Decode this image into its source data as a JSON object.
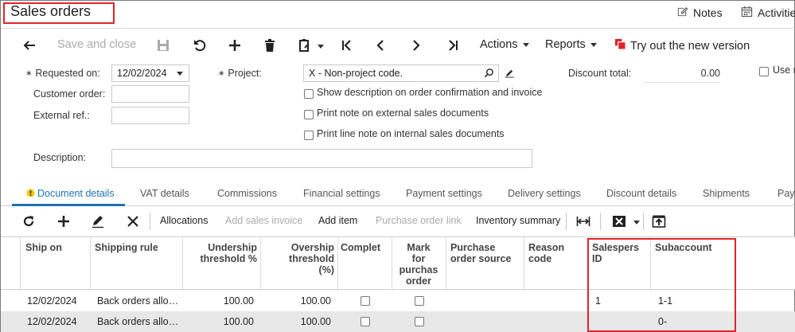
{
  "header": {
    "title": "Sales orders",
    "notes_label": "Notes",
    "activities_label": "Activitie"
  },
  "toolbar": {
    "save_close_label": "Save and close",
    "actions_label": "Actions",
    "reports_label": "Reports",
    "try_new_label": "Try out the new version"
  },
  "form": {
    "requested_on_label": "Requested on:",
    "requested_on_value": "12/02/2024",
    "customer_order_label": "Customer order:",
    "external_ref_label": "External ref.:",
    "description_label": "Description:",
    "project_label": "Project:",
    "project_value": "X - Non-project code.",
    "show_desc_label": "Show description on order confirmation and invoice",
    "print_note_external_label": "Print note on external sales documents",
    "print_line_note_label": "Print line note on internal sales documents",
    "discount_total_label": "Discount total:",
    "discount_total_value": "0.00",
    "use_label": "Use r"
  },
  "tabs": [
    {
      "label": "Document details"
    },
    {
      "label": "VAT details"
    },
    {
      "label": "Commissions"
    },
    {
      "label": "Financial settings"
    },
    {
      "label": "Payment settings"
    },
    {
      "label": "Delivery settings"
    },
    {
      "label": "Discount details"
    },
    {
      "label": "Shipments"
    },
    {
      "label": "Pay"
    }
  ],
  "grid_toolbar": {
    "allocations_label": "Allocations",
    "add_sales_invoice_label": "Add sales invoice",
    "add_item_label": "Add item",
    "purchase_order_link_label": "Purchase order link",
    "inventory_summary_label": "Inventory summary"
  },
  "grid": {
    "headers": {
      "ship_on": "Ship on",
      "shipping_rule": "Shipping rule",
      "undership_1": "Undership",
      "undership_2": "threshold %",
      "overship_1": "Overship",
      "overship_2": "threshold",
      "overship_3": "(%)",
      "complete": "Complet",
      "mark_1": "Mark",
      "mark_2": "for",
      "mark_3": "purchas",
      "mark_4": "order",
      "po_source_1": "Purchase",
      "po_source_2": "order source",
      "reason_1": "Reason",
      "reason_2": "code",
      "salesperson_1": "Salespers",
      "salesperson_2": "ID",
      "subaccount": "Subaccount"
    },
    "rows": [
      {
        "ship_on": "12/02/2024",
        "shipping_rule": "Back orders allo…",
        "undership": "100.00",
        "overship": "100.00",
        "salesperson": "1",
        "subaccount": "1-1"
      },
      {
        "ship_on": "12/02/2024",
        "shipping_rule": "Back orders allo…",
        "undership": "100.00",
        "overship": "100.00",
        "salesperson": "",
        "subaccount": "0-"
      }
    ]
  }
}
